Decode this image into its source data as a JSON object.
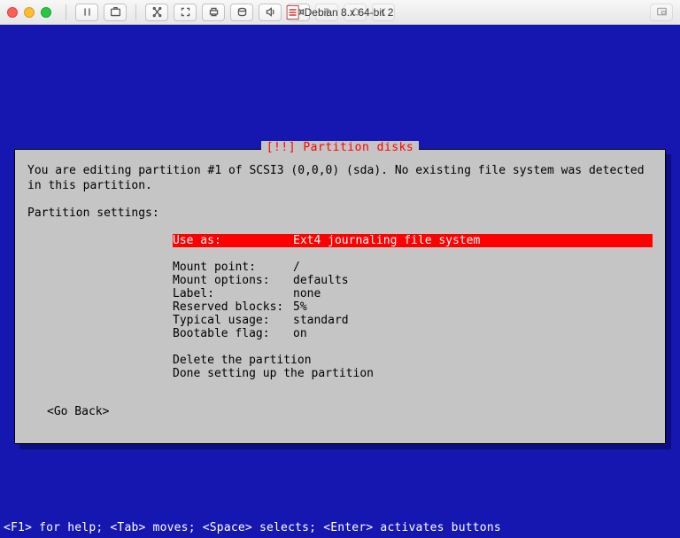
{
  "window": {
    "title": "Debian 8.x 64-bit 2"
  },
  "installer": {
    "box_title": "[!!] Partition disks",
    "intro": "You are editing partition #1 of SCSI3 (0,0,0) (sda). No existing file system was detected in this partition.",
    "heading": "Partition settings:",
    "settings": [
      {
        "label": "Use as:",
        "value": "Ext4 journaling file system",
        "selected": true
      },
      {
        "label": "",
        "value": "",
        "selected": false
      },
      {
        "label": "Mount point:",
        "value": "/",
        "selected": false
      },
      {
        "label": "Mount options:",
        "value": "defaults",
        "selected": false
      },
      {
        "label": "Label:",
        "value": "none",
        "selected": false
      },
      {
        "label": "Reserved blocks:",
        "value": "5%",
        "selected": false
      },
      {
        "label": "Typical usage:",
        "value": "standard",
        "selected": false
      },
      {
        "label": "Bootable flag:",
        "value": "on",
        "selected": false
      }
    ],
    "actions": {
      "delete": "Delete the partition",
      "done": "Done setting up the partition"
    },
    "go_back": "<Go Back>",
    "hint": "<F1> for help; <Tab> moves; <Space> selects; <Enter> activates buttons"
  }
}
